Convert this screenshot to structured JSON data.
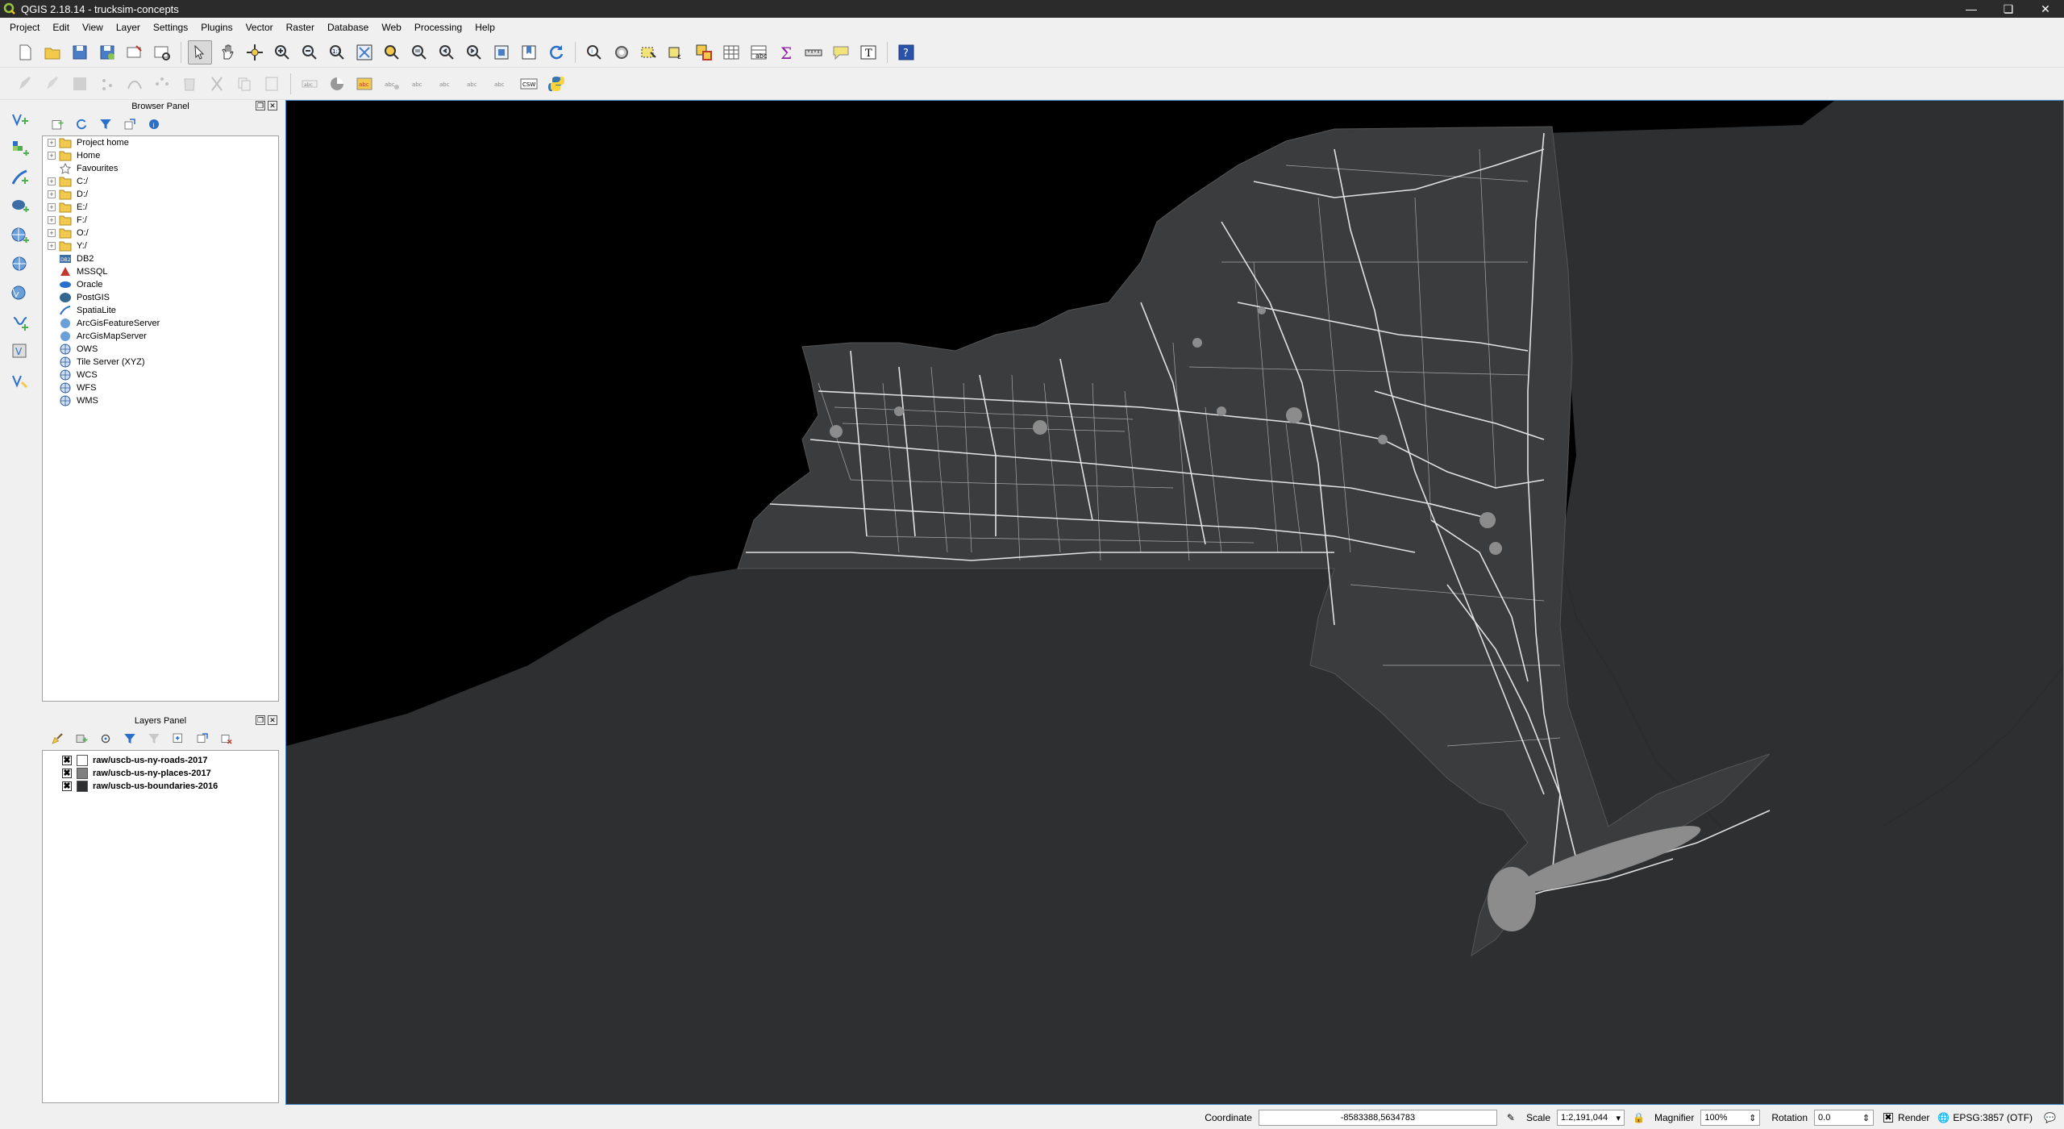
{
  "window": {
    "title": "QGIS 2.18.14 - trucksim-concepts"
  },
  "menu": [
    "Project",
    "Edit",
    "View",
    "Layer",
    "Settings",
    "Plugins",
    "Vector",
    "Raster",
    "Database",
    "Web",
    "Processing",
    "Help"
  ],
  "browser_panel": {
    "title": "Browser Panel",
    "items": [
      {
        "label": "Project home",
        "icon": "folder-icon",
        "expand": true
      },
      {
        "label": "Home",
        "icon": "folder-icon",
        "expand": true
      },
      {
        "label": "Favourites",
        "icon": "star-icon",
        "expand": false
      },
      {
        "label": "C:/",
        "icon": "folder-icon",
        "expand": true
      },
      {
        "label": "D:/",
        "icon": "folder-icon",
        "expand": true
      },
      {
        "label": "E:/",
        "icon": "folder-icon",
        "expand": true
      },
      {
        "label": "F:/",
        "icon": "folder-icon",
        "expand": true
      },
      {
        "label": "O:/",
        "icon": "folder-icon",
        "expand": true
      },
      {
        "label": "Y:/",
        "icon": "folder-icon",
        "expand": true
      },
      {
        "label": "DB2",
        "icon": "db2-icon",
        "expand": false
      },
      {
        "label": "MSSQL",
        "icon": "mssql-icon",
        "expand": false
      },
      {
        "label": "Oracle",
        "icon": "oracle-icon",
        "expand": false
      },
      {
        "label": "PostGIS",
        "icon": "postgis-icon",
        "expand": false
      },
      {
        "label": "SpatiaLite",
        "icon": "spatialite-icon",
        "expand": false
      },
      {
        "label": "ArcGisFeatureServer",
        "icon": "arcgis-icon",
        "expand": false
      },
      {
        "label": "ArcGisMapServer",
        "icon": "arcgis-icon",
        "expand": false
      },
      {
        "label": "OWS",
        "icon": "globe-icon",
        "expand": false
      },
      {
        "label": "Tile Server (XYZ)",
        "icon": "globe-icon",
        "expand": false
      },
      {
        "label": "WCS",
        "icon": "globe-icon",
        "expand": false
      },
      {
        "label": "WFS",
        "icon": "globe-icon",
        "expand": false
      },
      {
        "label": "WMS",
        "icon": "globe-icon",
        "expand": false
      }
    ]
  },
  "layers_panel": {
    "title": "Layers Panel",
    "layers": [
      {
        "name": "raw/uscb-us-ny-roads-2017",
        "checked": "✖",
        "symbol_color": "#ffffff"
      },
      {
        "name": "raw/uscb-us-ny-places-2017",
        "checked": "✖",
        "symbol_color": "#808080"
      },
      {
        "name": "raw/uscb-us-boundaries-2016",
        "checked": "✖",
        "symbol_color": "#2d2f31"
      }
    ]
  },
  "status": {
    "coordinate_label": "Coordinate",
    "coordinate_value": "-8583388,5634783",
    "scale_label": "Scale",
    "scale_value": "1:2,191,044",
    "magnifier_label": "Magnifier",
    "magnifier_value": "100%",
    "rotation_label": "Rotation",
    "rotation_value": "0.0",
    "render_label": "Render",
    "render_checked": "✖",
    "crs_label": "EPSG:3857 (OTF)"
  },
  "colors": {
    "map_background": "#000000",
    "land": "#2d2f31",
    "roads": "#ffffff",
    "places": "#8c8c8c",
    "selection_border": "#3c84c4"
  }
}
